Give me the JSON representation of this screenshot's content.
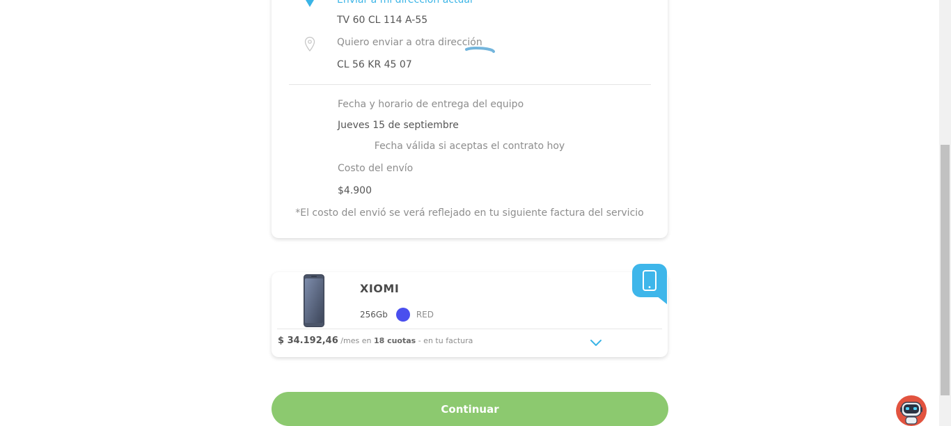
{
  "delivery": {
    "current_address_option": "Enviar a mi dirección actual",
    "current_address": "TV 60 CL 114 A-55",
    "other_address_option": "Quiero enviar a otra dirección",
    "other_address": "CL 56 KR 45 07",
    "date_label": "Fecha y horario de entrega del equipo",
    "date_value": "Jueves 15 de septiembre",
    "date_note": "Fecha válida si aceptas el contrato hoy",
    "cost_label": "Costo del envío",
    "cost_value": "$4.900",
    "cost_note": "*El costo del envió se verá reflejado en tu siguiente factura del servicio"
  },
  "product": {
    "name": "XIOMI",
    "storage": "256Gb",
    "color_name": "RED",
    "color_swatch": "#4a4fee",
    "price": "$ 34.192,46",
    "price_prefix": "/mes en",
    "cuotas": "18 cuotas",
    "price_suffix": "- en tu factura",
    "badge_icon": "smartphone-icon"
  },
  "actions": {
    "continue_label": "Continuar"
  },
  "colors": {
    "accent_blue": "#3ab4e6",
    "continue_green": "#8cc96f",
    "chatbot_red": "#e2533f"
  }
}
